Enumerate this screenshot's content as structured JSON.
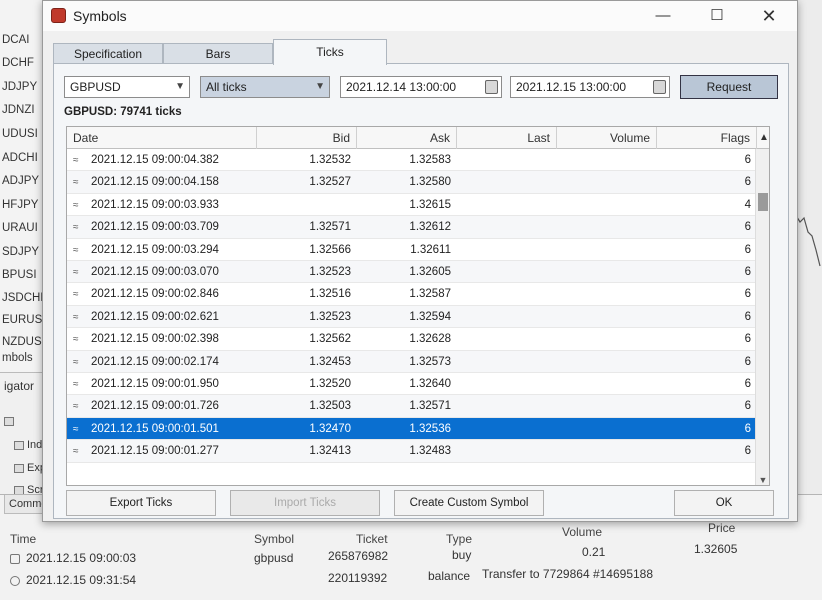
{
  "market_watch": {
    "symbols": [
      "DCAI",
      "DCHF",
      "JDJPY",
      "JDNZI",
      "UDUSI",
      "ADCHI",
      "ADJPY",
      "HFJPY",
      "URAUI",
      "SDJPY",
      "BPUSI",
      "JSDCHF",
      "EURUSD",
      "NZDUSI"
    ],
    "footer": "mbols"
  },
  "navigator": {
    "title": "igator",
    "items": [
      "Indi",
      "Exp",
      "Scri"
    ]
  },
  "toolbox": {
    "tab": "Common",
    "columns": [
      "Time",
      "Symbol",
      "Ticket",
      "Type",
      "Volume",
      "Price"
    ],
    "rows": [
      {
        "time": "2021.12.15 09:00:03",
        "symbol": "gbpusd",
        "ticket": "265876982",
        "type": "buy",
        "volume": "0.21",
        "price": "1.32605"
      },
      {
        "time": "2021.12.15 09:31:54",
        "symbol": "",
        "ticket": "220119392",
        "type": "balance",
        "comment": "Transfer to 7729864 #14695188"
      }
    ]
  },
  "dialog": {
    "title": "Symbols",
    "tabs": [
      "Specification",
      "Bars",
      "Ticks"
    ],
    "active_tab": "Ticks",
    "symbol_select": "GBPUSD",
    "filter_select": "All ticks",
    "date_from": "2021.12.14 13:00:00",
    "date_to": "2021.12.15 13:00:00",
    "request_label": "Request",
    "ticks_count": "GBPUSD: 79741 ticks",
    "columns": {
      "date": "Date",
      "bid": "Bid",
      "ask": "Ask",
      "last": "Last",
      "volume": "Volume",
      "flags": "Flags"
    },
    "rows": [
      {
        "date": "2021.12.15 09:00:04.382",
        "bid": "1.32532",
        "ask": "1.32583",
        "flags": "6"
      },
      {
        "date": "2021.12.15 09:00:04.158",
        "bid": "1.32527",
        "ask": "1.32580",
        "flags": "6"
      },
      {
        "date": "2021.12.15 09:00:03.933",
        "bid": "",
        "ask": "1.32615",
        "flags": "4"
      },
      {
        "date": "2021.12.15 09:00:03.709",
        "bid": "1.32571",
        "ask": "1.32612",
        "flags": "6"
      },
      {
        "date": "2021.12.15 09:00:03.294",
        "bid": "1.32566",
        "ask": "1.32611",
        "flags": "6"
      },
      {
        "date": "2021.12.15 09:00:03.070",
        "bid": "1.32523",
        "ask": "1.32605",
        "flags": "6"
      },
      {
        "date": "2021.12.15 09:00:02.846",
        "bid": "1.32516",
        "ask": "1.32587",
        "flags": "6"
      },
      {
        "date": "2021.12.15 09:00:02.621",
        "bid": "1.32523",
        "ask": "1.32594",
        "flags": "6"
      },
      {
        "date": "2021.12.15 09:00:02.398",
        "bid": "1.32562",
        "ask": "1.32628",
        "flags": "6"
      },
      {
        "date": "2021.12.15 09:00:02.174",
        "bid": "1.32453",
        "ask": "1.32573",
        "flags": "6"
      },
      {
        "date": "2021.12.15 09:00:01.950",
        "bid": "1.32520",
        "ask": "1.32640",
        "flags": "6"
      },
      {
        "date": "2021.12.15 09:00:01.726",
        "bid": "1.32503",
        "ask": "1.32571",
        "flags": "6"
      },
      {
        "date": "2021.12.15 09:00:01.501",
        "bid": "1.32470",
        "ask": "1.32536",
        "flags": "6"
      },
      {
        "date": "2021.12.15 09:00:01.277",
        "bid": "1.32413",
        "ask": "1.32483",
        "flags": "6"
      }
    ],
    "selected_row_index": 12,
    "buttons": {
      "export": "Export Ticks",
      "import": "Import Ticks",
      "custom": "Create Custom Symbol",
      "ok": "OK"
    },
    "colors": {
      "selection": "#0a6fd0",
      "brand": "#c0392b"
    }
  }
}
